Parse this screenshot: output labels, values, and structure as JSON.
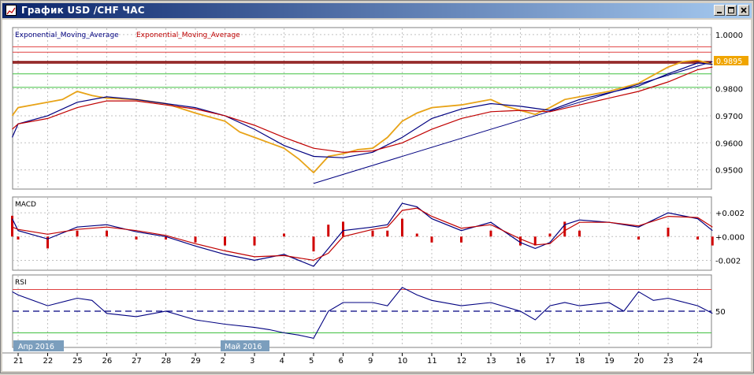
{
  "window": {
    "title": "График USD /CHF ЧАС"
  },
  "colors": {
    "price": "#e8a317",
    "ema_fast": "#000080",
    "ema_slow": "#c00000",
    "trendline": "#000080",
    "hline_red": "#e04040",
    "hline_green": "#40c040",
    "hline_dark": "#800000",
    "macd_hist": "#d00000",
    "rsi": "#000080",
    "rsi_overbought": "#cc44cc",
    "rsi_oversold": "#33cc33",
    "grid": "#c0c0c0",
    "price_tag_bg": "#f0a500"
  },
  "chart_data": [
    {
      "type": "line",
      "panel": "price",
      "legend": [
        "Exponential_Moving_Average",
        "Exponential_Moving_Average"
      ],
      "y_ticks": [
        "1.0000",
        "0.9900",
        "0.9800",
        "0.9700",
        "0.9600",
        "0.9500"
      ],
      "ylim": [
        0.9435,
        1.002
      ],
      "current_price_label": "0.9895",
      "horizontal_levels": [
        {
          "value": 0.9955,
          "color": "red"
        },
        {
          "value": 0.9935,
          "color": "red"
        },
        {
          "value": 0.99,
          "color": "dark red"
        },
        {
          "value": 0.9895,
          "color": "dark red"
        },
        {
          "value": 0.9855,
          "color": "green"
        },
        {
          "value": 0.9805,
          "color": "green"
        }
      ],
      "trendline": {
        "from": {
          "x": 10.0,
          "y": 0.945
        },
        "to": {
          "x": 23.5,
          "y": 0.99
        }
      },
      "series": [
        {
          "name": "price",
          "points": [
            [
              -0.2,
              0.97
            ],
            [
              0,
              0.973
            ],
            [
              1,
              0.975
            ],
            [
              1.5,
              0.976
            ],
            [
              2,
              0.979
            ],
            [
              2.5,
              0.9775
            ],
            [
              3,
              0.9765
            ],
            [
              4,
              0.976
            ],
            [
              5,
              0.9745
            ],
            [
              6,
              0.971
            ],
            [
              7,
              0.968
            ],
            [
              7.5,
              0.964
            ],
            [
              8,
              0.962
            ],
            [
              8.5,
              0.96
            ],
            [
              9,
              0.958
            ],
            [
              9.5,
              0.954
            ],
            [
              10,
              0.949
            ],
            [
              10.5,
              0.955
            ],
            [
              11,
              0.956
            ],
            [
              11.5,
              0.9575
            ],
            [
              12,
              0.958
            ],
            [
              12.5,
              0.962
            ],
            [
              13,
              0.968
            ],
            [
              13.5,
              0.971
            ],
            [
              14,
              0.973
            ],
            [
              15,
              0.974
            ],
            [
              16,
              0.976
            ],
            [
              16.5,
              0.9735
            ],
            [
              17,
              0.972
            ],
            [
              17.5,
              0.9705
            ],
            [
              18,
              0.973
            ],
            [
              18.5,
              0.976
            ],
            [
              19,
              0.977
            ],
            [
              20,
              0.979
            ],
            [
              21,
              0.982
            ],
            [
              22,
              0.988
            ],
            [
              22.5,
              0.99
            ],
            [
              23,
              0.9905
            ],
            [
              23.5,
              0.989
            ]
          ]
        },
        {
          "name": "ema_fast",
          "points": [
            [
              -0.2,
              0.962
            ],
            [
              0,
              0.967
            ],
            [
              1,
              0.97
            ],
            [
              2,
              0.975
            ],
            [
              3,
              0.977
            ],
            [
              4,
              0.976
            ],
            [
              5,
              0.9745
            ],
            [
              6,
              0.973
            ],
            [
              7,
              0.97
            ],
            [
              8,
              0.965
            ],
            [
              9,
              0.959
            ],
            [
              10,
              0.955
            ],
            [
              11,
              0.9545
            ],
            [
              12,
              0.9565
            ],
            [
              13,
              0.962
            ],
            [
              14,
              0.969
            ],
            [
              15,
              0.9725
            ],
            [
              16,
              0.9745
            ],
            [
              17,
              0.9735
            ],
            [
              18,
              0.972
            ],
            [
              19,
              0.976
            ],
            [
              20,
              0.9785
            ],
            [
              21,
              0.981
            ],
            [
              22,
              0.9855
            ],
            [
              23,
              0.9895
            ],
            [
              23.5,
              0.989
            ]
          ]
        },
        {
          "name": "ema_slow",
          "points": [
            [
              -0.2,
              0.965
            ],
            [
              0,
              0.967
            ],
            [
              1,
              0.969
            ],
            [
              2,
              0.973
            ],
            [
              3,
              0.9755
            ],
            [
              4,
              0.9755
            ],
            [
              5,
              0.974
            ],
            [
              6,
              0.9725
            ],
            [
              7,
              0.97
            ],
            [
              8,
              0.9665
            ],
            [
              9,
              0.962
            ],
            [
              10,
              0.958
            ],
            [
              11,
              0.9565
            ],
            [
              12,
              0.957
            ],
            [
              13,
              0.96
            ],
            [
              14,
              0.965
            ],
            [
              15,
              0.969
            ],
            [
              16,
              0.9715
            ],
            [
              17,
              0.972
            ],
            [
              18,
              0.9715
            ],
            [
              19,
              0.974
            ],
            [
              20,
              0.9765
            ],
            [
              21,
              0.979
            ],
            [
              22,
              0.9825
            ],
            [
              23,
              0.987
            ],
            [
              23.5,
              0.988
            ]
          ]
        }
      ]
    },
    {
      "type": "line",
      "panel": "macd",
      "label": "MACD",
      "y_ticks": [
        "+0.002",
        "+0.000",
        "-0.002"
      ],
      "ylim": [
        -0.0027,
        0.0032
      ],
      "series": [
        {
          "name": "macd",
          "points": [
            [
              -0.2,
              0.0015
            ],
            [
              0,
              0.0005
            ],
            [
              1,
              -0.0002
            ],
            [
              2,
              0.0008
            ],
            [
              3,
              0.001
            ],
            [
              4,
              0.0004
            ],
            [
              5,
              0.0
            ],
            [
              6,
              -0.0008
            ],
            [
              7,
              -0.0015
            ],
            [
              8,
              -0.002
            ],
            [
              9,
              -0.0015
            ],
            [
              10,
              -0.0025
            ],
            [
              10.5,
              -0.001
            ],
            [
              11,
              0.0005
            ],
            [
              12,
              0.0008
            ],
            [
              12.5,
              0.001
            ],
            [
              13,
              0.0028
            ],
            [
              13.5,
              0.0025
            ],
            [
              14,
              0.0015
            ],
            [
              15,
              0.0005
            ],
            [
              16,
              0.0012
            ],
            [
              17,
              -0.0005
            ],
            [
              17.5,
              -0.001
            ],
            [
              18,
              -0.0005
            ],
            [
              18.5,
              0.001
            ],
            [
              19,
              0.0014
            ],
            [
              20,
              0.0012
            ],
            [
              21,
              0.0008
            ],
            [
              22,
              0.002
            ],
            [
              23,
              0.0015
            ],
            [
              23.5,
              0.0005
            ]
          ]
        },
        {
          "name": "signal",
          "points": [
            [
              -0.2,
              0.0008
            ],
            [
              0,
              0.0006
            ],
            [
              1,
              0.0002
            ],
            [
              2,
              0.0006
            ],
            [
              3,
              0.0008
            ],
            [
              4,
              0.0005
            ],
            [
              5,
              0.0001
            ],
            [
              6,
              -0.0006
            ],
            [
              7,
              -0.0012
            ],
            [
              8,
              -0.0017
            ],
            [
              9,
              -0.0016
            ],
            [
              10,
              -0.002
            ],
            [
              10.5,
              -0.0014
            ],
            [
              11,
              0.0
            ],
            [
              12,
              0.0006
            ],
            [
              12.5,
              0.0008
            ],
            [
              13,
              0.0022
            ],
            [
              13.5,
              0.0024
            ],
            [
              14,
              0.0017
            ],
            [
              15,
              0.0007
            ],
            [
              16,
              0.001
            ],
            [
              17,
              -0.0002
            ],
            [
              17.5,
              -0.0007
            ],
            [
              18,
              -0.0006
            ],
            [
              18.5,
              0.0005
            ],
            [
              19,
              0.0012
            ],
            [
              20,
              0.0012
            ],
            [
              21,
              0.0009
            ],
            [
              22,
              0.0017
            ],
            [
              23,
              0.0016
            ],
            [
              23.5,
              0.0008
            ]
          ]
        }
      ]
    },
    {
      "type": "line",
      "panel": "rsi",
      "label": "RSI",
      "y_ticks": [
        "50"
      ],
      "ylim": [
        18,
        82
      ],
      "levels": [
        70,
        50,
        30
      ],
      "series": [
        {
          "name": "rsi",
          "points": [
            [
              -0.2,
              68
            ],
            [
              0,
              65
            ],
            [
              1,
              55
            ],
            [
              2,
              62
            ],
            [
              2.5,
              60
            ],
            [
              3,
              48
            ],
            [
              4,
              45
            ],
            [
              5,
              50
            ],
            [
              6,
              42
            ],
            [
              7,
              38
            ],
            [
              8,
              35
            ],
            [
              8.5,
              33
            ],
            [
              9,
              30
            ],
            [
              9.5,
              28
            ],
            [
              10,
              25
            ],
            [
              10.5,
              50
            ],
            [
              11,
              58
            ],
            [
              12,
              58
            ],
            [
              12.5,
              55
            ],
            [
              13,
              72
            ],
            [
              13.5,
              65
            ],
            [
              14,
              60
            ],
            [
              15,
              55
            ],
            [
              16,
              58
            ],
            [
              17,
              50
            ],
            [
              17.5,
              42
            ],
            [
              18,
              55
            ],
            [
              18.5,
              58
            ],
            [
              19,
              55
            ],
            [
              20,
              58
            ],
            [
              20.5,
              50
            ],
            [
              21,
              68
            ],
            [
              21.5,
              60
            ],
            [
              22,
              62
            ],
            [
              23,
              55
            ],
            [
              23.5,
              48
            ]
          ]
        }
      ]
    }
  ],
  "x_axis": {
    "ticks": [
      "21",
      "22",
      "25",
      "26",
      "27",
      "28",
      "29",
      "2",
      "3",
      "4",
      "5",
      "6",
      "9",
      "10",
      "11",
      "12",
      "13",
      "16",
      "17",
      "18",
      "19",
      "20",
      "23",
      "24"
    ],
    "month_labels": [
      "Апр 2016",
      "Май 2016"
    ]
  }
}
